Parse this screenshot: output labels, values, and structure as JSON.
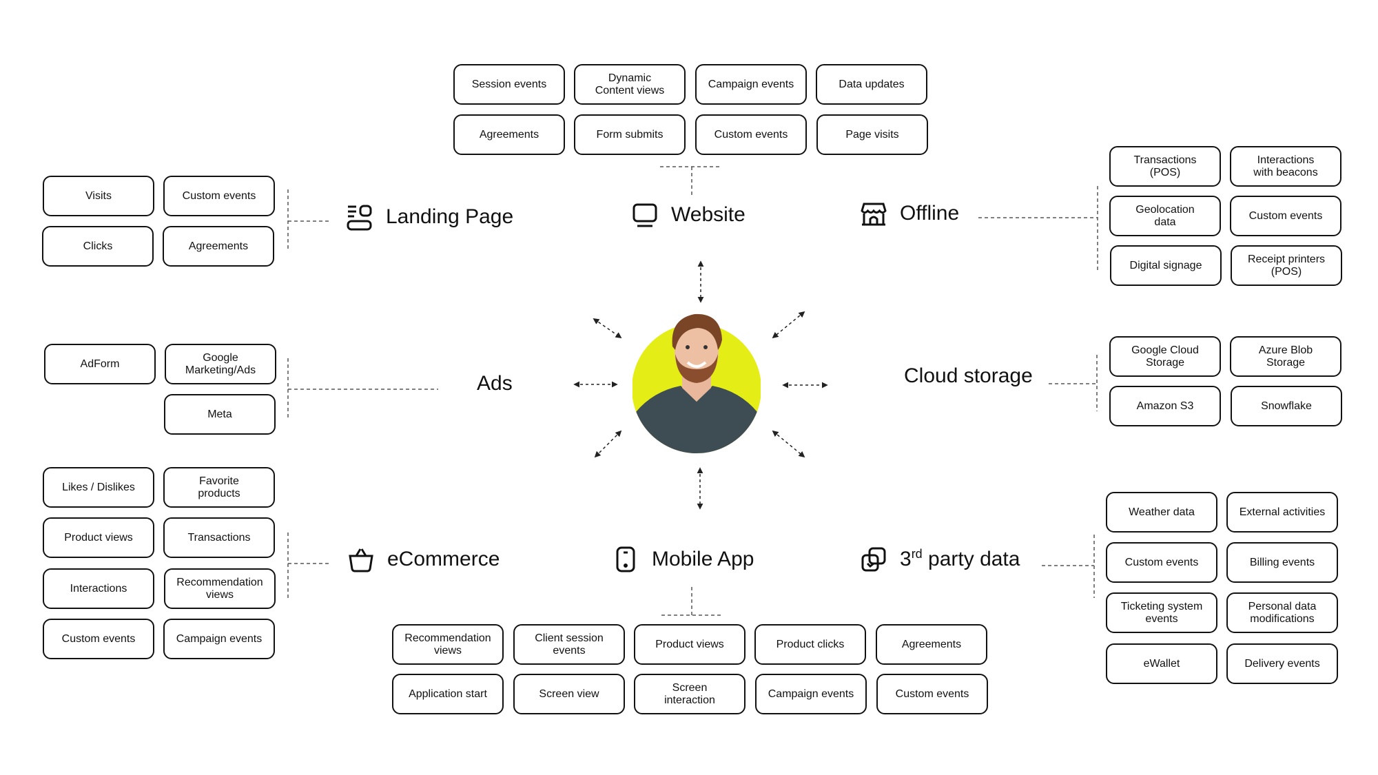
{
  "center": {
    "name": "customer-profile",
    "accent_color": "#E4EE16",
    "shirt_color": "#3E4D54"
  },
  "sections": {
    "website": {
      "title": "Website",
      "icon": "monitor-icon",
      "items": [
        "Session events",
        "Dynamic\nContent views",
        "Campaign events",
        "Data updates",
        "Agreements",
        "Form submits",
        "Custom events",
        "Page visits"
      ]
    },
    "landing_page": {
      "title": "Landing Page",
      "icon": "layout-blocks-icon",
      "items": [
        "Visits",
        "Custom events",
        "Clicks",
        "Agreements"
      ]
    },
    "offline": {
      "title": "Offline",
      "icon": "storefront-icon",
      "items": [
        "Transactions\n(POS)",
        "Interactions\nwith beacons",
        "Geolocation\ndata",
        "Custom events",
        "Digital signage",
        "Receipt printers\n(POS)"
      ]
    },
    "ads": {
      "title": "Ads",
      "items": [
        "AdForm",
        "Google\nMarketing/Ads",
        "Meta"
      ]
    },
    "cloud_storage": {
      "title": "Cloud storage",
      "items": [
        "Google Cloud\nStorage",
        "Azure Blob\nStorage",
        "Amazon S3",
        "Snowflake"
      ]
    },
    "ecommerce": {
      "title": "eCommerce",
      "icon": "basket-icon",
      "items": [
        "Likes / Dislikes",
        "Favorite\nproducts",
        "Product views",
        "Transactions",
        "Interactions",
        "Recommendation\nviews",
        "Custom events",
        "Campaign events"
      ]
    },
    "mobile_app": {
      "title": "Mobile App",
      "icon": "smartphone-icon",
      "items": [
        "Recommendation\nviews",
        "Client session\nevents",
        "Product views",
        "Product clicks",
        "Agreements",
        "Application start",
        "Screen view",
        "Screen\ninteraction",
        "Campaign events",
        "Custom events"
      ]
    },
    "third_party": {
      "title_prefix": "3",
      "title_sup": "rd",
      "title_rest": " party data",
      "icon": "overlapping-squares-icon",
      "items": [
        "Weather data",
        "External activities",
        "Custom events",
        "Billing events",
        "Ticketing system\nevents",
        "Personal data\nmodifications",
        "eWallet",
        "Delivery events"
      ]
    }
  }
}
